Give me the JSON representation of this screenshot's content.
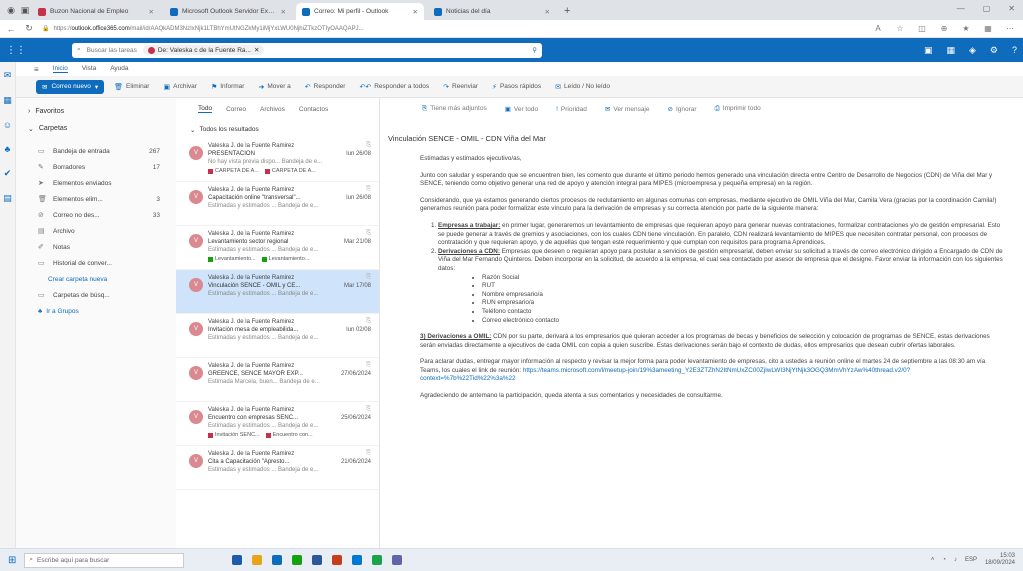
{
  "browser": {
    "tabs": [
      {
        "label": "Buzon Nacional de Empleo",
        "active": false,
        "color": "#c4314b"
      },
      {
        "label": "Microsoft Outlook Servidor Exchange",
        "active": false,
        "color": "#0f6cbd"
      },
      {
        "label": "Correo: Mi perfil - Outlook",
        "active": true,
        "color": "#0f6cbd"
      },
      {
        "label": "Noticias del día",
        "active": false,
        "color": "#0f6cbd"
      }
    ],
    "url_host": "outlook.office365.com",
    "url_rest": "/mail/id/AAQkADM3NzIxNjk1LTBhYmUtNGZkMy1iMjYxLWU0NjhiZTkzOTIyOAAQAPJ..."
  },
  "owa": {
    "search_placeholder": "Buscar las tareas",
    "search_chip": "De: Valeska c de la Fuente Ra...",
    "ribbon_tabs": [
      "Inicio",
      "Vista",
      "Ayuda"
    ],
    "new_mail": "Correo nuevo",
    "ribbon": [
      "Eliminar",
      "Archivar",
      "Informar",
      "Mover a",
      "Responder",
      "Responder a todos",
      "Reenviar",
      "Pasos rápidos",
      "Leído / No leído"
    ]
  },
  "folders": {
    "favorites": "Favoritos",
    "carpetas": "Carpetas",
    "items": [
      {
        "icon": "inbox-icon",
        "glyph": "▭",
        "label": "Bandeja de entrada",
        "count": "267"
      },
      {
        "icon": "draft-icon",
        "glyph": "✎",
        "label": "Borradores",
        "count": "17"
      },
      {
        "icon": "send-icon",
        "glyph": "➤",
        "label": "Elementos enviados",
        "count": ""
      },
      {
        "icon": "trash-icon",
        "glyph": "🗑",
        "label": "Elementos elim...",
        "count": "3"
      },
      {
        "icon": "junk-icon",
        "glyph": "⊘",
        "label": "Correo no des...",
        "count": "33"
      },
      {
        "icon": "archive-icon",
        "glyph": "▤",
        "label": "Archivo",
        "count": ""
      },
      {
        "icon": "notes-icon",
        "glyph": "✐",
        "label": "Notas",
        "count": ""
      },
      {
        "icon": "history-icon",
        "glyph": "▭",
        "label": "Historial de conver...",
        "count": ""
      }
    ],
    "create_folder": "Crear carpeta nueva",
    "search_folder": "Carpetas de búsq...",
    "go_groups": "Ir a Grupos"
  },
  "list": {
    "filters": [
      "Todo",
      "Correo",
      "Archivos",
      "Contactos"
    ],
    "results_label": "Todos los resultados",
    "messages": [
      {
        "from": "Valeska J. de la Fuente Ramirez",
        "subject": "PRESENTACIÓN",
        "date": "lun 26/08",
        "preview": "No hay vista previa dispo...  Bandeja de e...",
        "tags": [
          "CARPETA DE A...",
          "CARPETA DE A..."
        ],
        "tag_color": "r",
        "sel": false
      },
      {
        "from": "Valeska J. de la Fuente Ramirez",
        "subject": "Capacitación online \"transversal\"...",
        "date": "lun 26/08",
        "preview": "Estimadas y estimados ...  Bandeja de e...",
        "tags": [],
        "tag_color": "r",
        "sel": false
      },
      {
        "from": "Valeska J. de la Fuente Ramirez",
        "subject": "Levantamiento sector regional",
        "date": "Mar 21/08",
        "preview": "Estimadas y estimados ...  Bandeja de e...",
        "tags": [
          "Levantamiento...",
          "Levantamiento..."
        ],
        "tag_color": "g",
        "sel": false
      },
      {
        "from": "Valeska J. de la Fuente Ramirez",
        "subject": "Vinculación SENCE - OMIL y CE...",
        "date": "Mar 17/08",
        "preview": "Estimadas y estimados ...  Bandeja de e...",
        "tags": [],
        "tag_color": "r",
        "sel": true
      },
      {
        "from": "Valeska J. de la Fuente Ramirez",
        "subject": "Invitación mesa de empleabilida...",
        "date": "lun 02/08",
        "preview": "Estimadas y estimados ...  Bandeja de e...",
        "tags": [],
        "tag_color": "r",
        "sel": false
      },
      {
        "from": "Valeska J. de la Fuente Ramirez",
        "subject": "GREENCE, SENCE MAYOR EXP...",
        "date": "27/06/2024",
        "preview": "Estimada Marcela, buen...  Bandeja de e...",
        "tags": [],
        "tag_color": "r",
        "sel": false
      },
      {
        "from": "Valeska J. de la Fuente Ramirez",
        "subject": "Encuentro con empresas SENC...",
        "date": "25/06/2024",
        "preview": "Estimadas y estimados ...  Bandeja de e...",
        "tags": [
          "Invitación SENC...",
          "Encuentro con..."
        ],
        "tag_color": "r",
        "sel": false
      },
      {
        "from": "Valeska J. de la Fuente Ramirez",
        "subject": "Cita a Capacitación \"Apresto...",
        "date": "21/06/2024",
        "preview": "Estimadas y estimados ...  Bandeja de e...",
        "tags": [],
        "tag_color": "r",
        "sel": false
      }
    ]
  },
  "reading": {
    "actions": [
      "Tiene más adjuntos",
      "Ver todo",
      "Prioridad",
      "Ver mensaje",
      "Ignorar",
      "Imprimir todo"
    ],
    "subject": "Vinculación SENCE - OMIL - CDN Viña del Mar",
    "greeting": "Estimadas y estimados ejecutivo/as,",
    "p1": "Junto con saludar y esperando que se encuentren bien, les comento que durante el último periodo hemos generado una vinculación directa entre Centro de Desarrollo de Negocios (CDN) de Viña del Mar y SENCE, teniendo como objetivo generar una red de apoyo y atención integral para MIPES (microempresa y pequeña empresa) en la región.",
    "p2": "Considerando, que ya estamos generando ciertos procesos de reclutamiento en algunas comunas con empresas, mediante ejecutivo de OMIL Viña del Mar, Camila Vera (gracias por la coordinación Camila!) generamos reunión para poder formalizar este vínculo para la derivación de empresas y su correcta atención por parte de la siguiente manera:",
    "l1_title": "Empresas a trabajar:",
    "l1": " en primer lugar, generaremos un levantamiento de empresas que requieran apoyo para generar nuevas contrataciones, formalizar contrataciones y/o de gestión empresarial. Esto se puede generar a través de gremios y asociaciones, con los cuales CDN tiene vinculación. En paralelo, CDN realizará levantamiento de MIPES que necesiten contratar personal, con procesos de contratación y que requieran apoyo, y de aquellas que tengan este requerimiento y que cumplan con requisitos para programa Aprendices.",
    "l2_title": "Derivaciones a CDN:",
    "l2": " Empresas que deseen o requieran apoyo para postular a servicios de gestión empresarial, deben enviar su solicitud a través de correo electrónico dirigido a Encargado de CDN de Viña del Mar Fernando Quinteros. Deben incorporar en la solicitud, de acuerdo a la empresa, el cual sea contactado por asesor de empresa que el designe. Favor enviar la información con los siguientes datos:",
    "bullets": [
      "Razón Social",
      "RUT",
      "Nombre empresario/a",
      "RUN empresario/a",
      "Teléfono contacto",
      "Correo electrónico contacto"
    ],
    "p3_title": "3) Derivaciones a OMIL:",
    "p3": " CDN por su parte, derivará a los empresarios que quieran acceder a los programas de becas y beneficios de selección y colocación de programas de SENCE, estas derivaciones serán enviadas directamente a ejecutivos de cada OMIL con copia a quien suscribe. Estas derivaciones serán bajo el contexto de dudas, ellos empresarios que desean cubrir ofertas laborales.",
    "p4": "Para aclarar dudas, entregar mayor información al respecto y revisar la mejor forma para poder levantamiento de empresas, cito a ustedes a reunión online el martes 24 de septiembre a las 08:30 am vía Teams, los cuales el link de reunión:",
    "link": "https://teams.microsoft.com/l/meetup-join/19%3ameeting_Y2E3ZTZhN2ItNmUxZC00ZjIwLWI3NjYtNjk3OGQ3MmVhYzAw%40thread.v2/0?context=%7b%22Tid%22%3a%22",
    "p5": "Agradeciendo de antemano la participación, queda atenta a sus comentarios y necesidades de consultarme."
  },
  "taskbar": {
    "search_placeholder": "Escribe aquí para buscar",
    "tray_label": "ESP",
    "time": "15:03",
    "date": "18/09/2024"
  },
  "colors": {
    "brand": "#0f6cbd",
    "selected": "#cfe4fa",
    "avatar": "#d9898f"
  }
}
